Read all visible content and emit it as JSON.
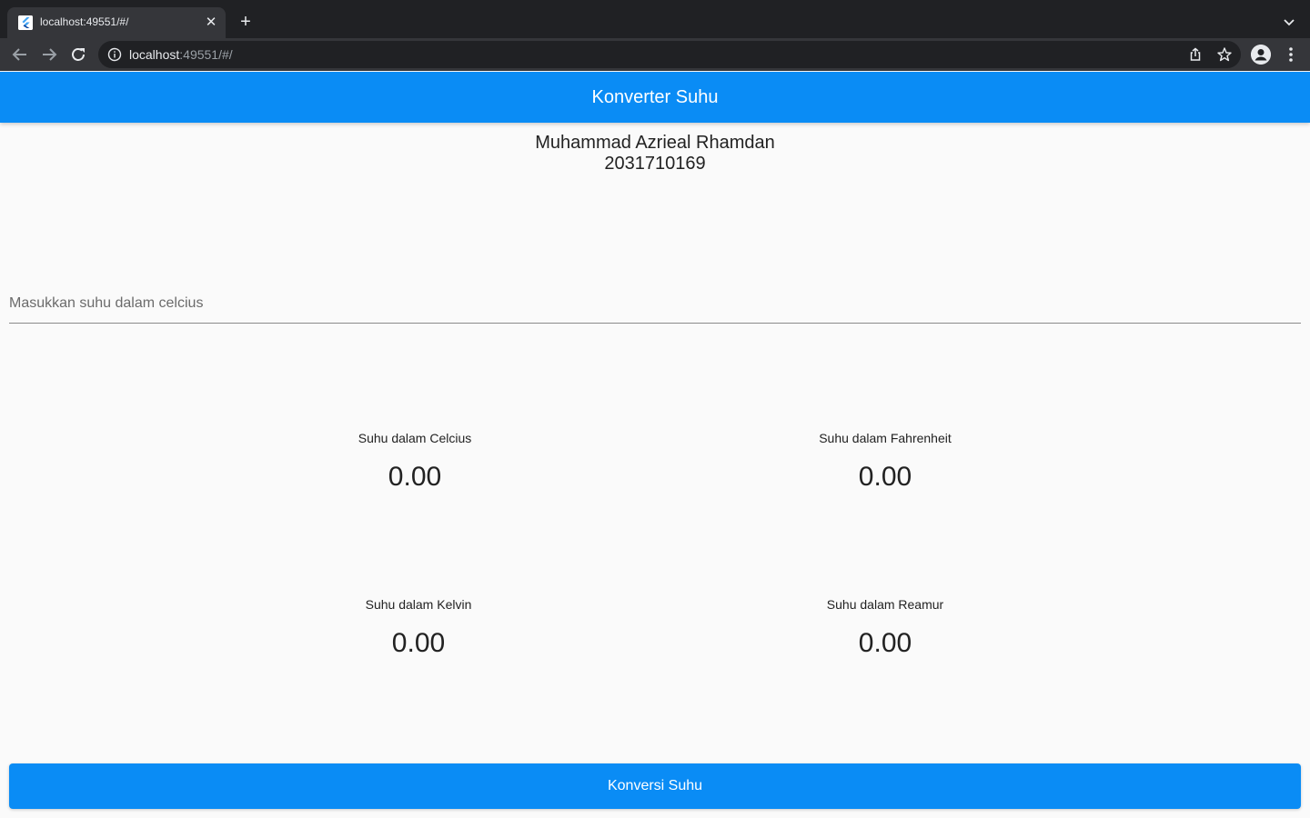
{
  "browser": {
    "tab_title": "localhost:49551/#/",
    "url_host": "localhost",
    "url_rest": ":49551/#/"
  },
  "app": {
    "title": "Konverter Suhu",
    "author_name": "Muhammad Azrieal Rhamdan",
    "author_id": "2031710169",
    "input_placeholder": "Masukkan suhu dalam celcius",
    "results": {
      "celcius": {
        "label": "Suhu dalam Celcius",
        "value": "0.00"
      },
      "fahrenheit": {
        "label": "Suhu dalam Fahrenheit",
        "value": "0.00"
      },
      "kelvin": {
        "label": "Suhu dalam Kelvin",
        "value": "0.00"
      },
      "reamur": {
        "label": "Suhu dalam Reamur",
        "value": "0.00"
      }
    },
    "convert_button": "Konversi Suhu"
  },
  "colors": {
    "primary": "#0a8cf5",
    "background": "#fafafa",
    "chrome_dark": "#202124",
    "chrome_tab": "#35363a"
  },
  "icons": [
    "flutter-favicon-icon",
    "close-icon",
    "plus-icon",
    "chevron-down-icon",
    "back-arrow-icon",
    "forward-arrow-icon",
    "reload-icon",
    "info-icon",
    "share-icon",
    "star-icon",
    "profile-icon",
    "more-vert-icon"
  ]
}
